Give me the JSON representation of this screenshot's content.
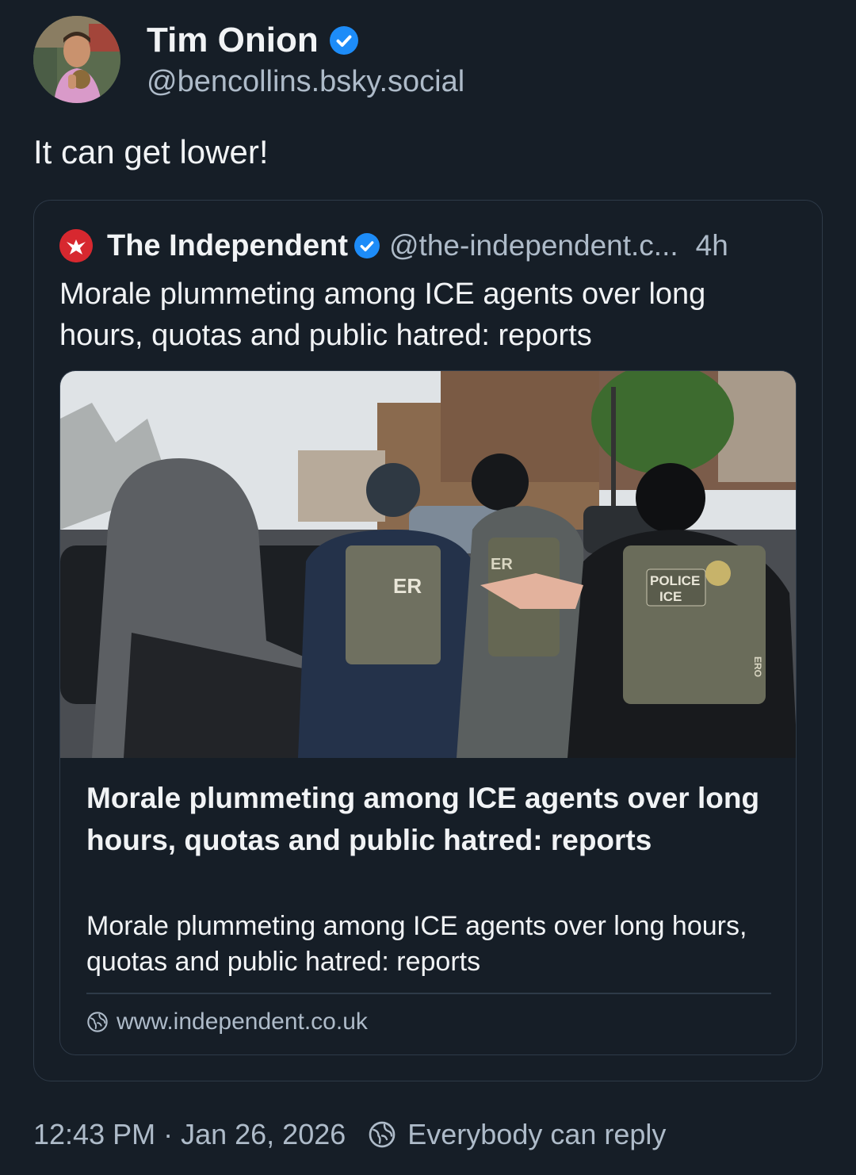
{
  "post": {
    "author_name": "Tim Onion",
    "author_handle": "@bencollins.bsky.social",
    "text": "It can get lower!",
    "timestamp": "12:43 PM · Jan 26, 2026",
    "reply_setting": "Everybody can reply"
  },
  "quote": {
    "author_name": "The Independent",
    "author_handle": "@the-independent.c...",
    "time": "4h",
    "text": "Morale plummeting among ICE agents over long hours, quotas and public hatred: reports",
    "card": {
      "title": "Morale plummeting among ICE agents over long hours, quotas and public hatred: reports",
      "description": "Morale plummeting among ICE agents over long hours, quotas and public hatred: reports",
      "domain": "www.independent.co.uk",
      "image_labels": {
        "vest_left": "ER",
        "vest_mid": "ER",
        "vest_right_line1": "POLICE",
        "vest_right_line2": "ICE",
        "vest_side": "ERO"
      }
    }
  },
  "colors": {
    "background": "#161e27",
    "border": "#2e3a48",
    "text_primary": "#f1f3f5",
    "text_secondary": "#aebbc9",
    "verified_blue": "#1d8cf8",
    "independent_red": "#d7282f"
  },
  "icons": {
    "verified": "verified-check-icon",
    "globe": "globe-icon",
    "logo": "independent-eagle-logo"
  }
}
